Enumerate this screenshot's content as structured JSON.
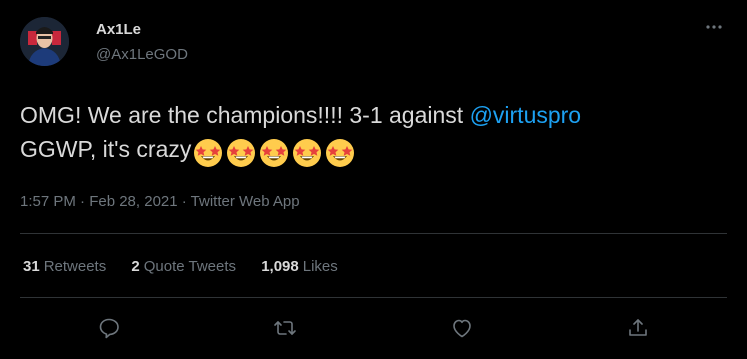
{
  "user": {
    "display_name": "Ax1Le",
    "handle": "@Ax1LeGOD"
  },
  "tweet": {
    "text_part1": "OMG! We are the champions!!!! 3-1 against ",
    "mention": "@virtuspro",
    "text_part2": "GGWP, it's crazy",
    "emoji_names": [
      "star-struck-emoji",
      "star-struck-emoji",
      "star-struck-emoji",
      "star-struck-emoji",
      "star-struck-emoji"
    ],
    "meta": "1:57 PM · Feb 28, 2021 · Twitter Web App"
  },
  "stats": {
    "retweets_count": "31",
    "retweets_label": "Retweets",
    "quotes_count": "2",
    "quotes_label": "Quote Tweets",
    "likes_count": "1,098",
    "likes_label": "Likes"
  },
  "actions": [
    "reply-icon",
    "retweet-icon",
    "like-icon",
    "share-icon"
  ],
  "colors": {
    "background": "#000000",
    "text": "#d9d9d9",
    "secondary": "#6e767d",
    "link": "#1da1f2",
    "divider": "#2f3336"
  }
}
